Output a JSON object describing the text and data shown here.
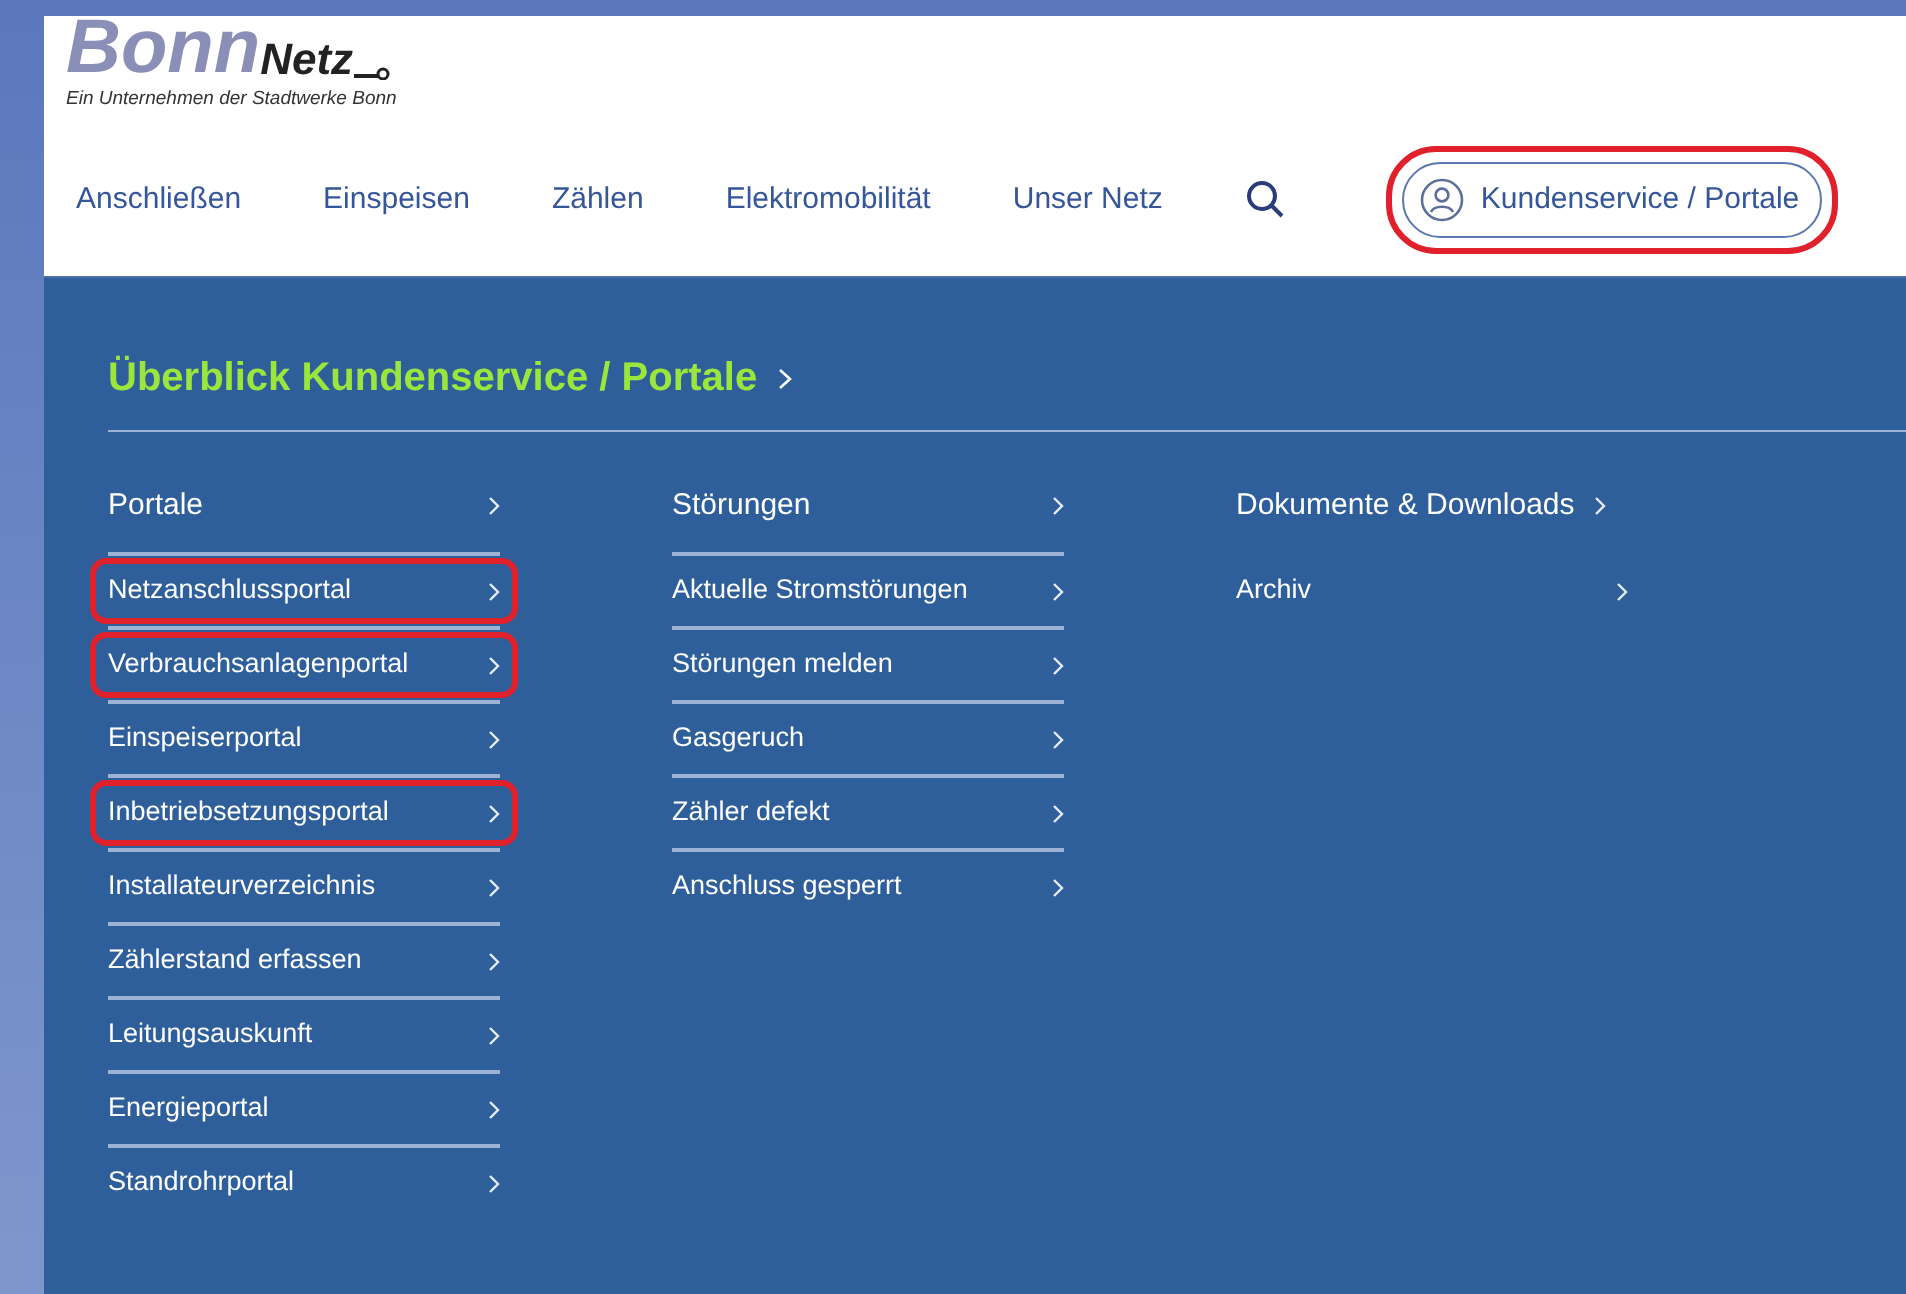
{
  "logo": {
    "brand_part_1": "Bonn",
    "brand_part_2": "Netz",
    "tagline": "Ein Unternehmen der Stadtwerke Bonn"
  },
  "nav": {
    "items": [
      "Anschließen",
      "Einspeisen",
      "Zählen",
      "Elektromobilität",
      "Unser Netz"
    ],
    "account_button": {
      "label": "Kundenservice / Portale",
      "highlighted": true
    }
  },
  "menu": {
    "title": "Überblick Kundenservice / Portale",
    "columns": [
      {
        "heading": "Portale",
        "items": [
          {
            "label": "Netzanschlussportal",
            "highlighted": true
          },
          {
            "label": "Verbrauchsanlagenportal",
            "highlighted": true
          },
          {
            "label": "Einspeiserportal",
            "highlighted": false
          },
          {
            "label": "Inbetriebsetzungsportal",
            "highlighted": true
          },
          {
            "label": "Installateurverzeichnis",
            "highlighted": false
          },
          {
            "label": "Zählerstand erfassen",
            "highlighted": false
          },
          {
            "label": "Leitungsauskunft",
            "highlighted": false
          },
          {
            "label": "Energieportal",
            "highlighted": false
          },
          {
            "label": "Standrohrportal",
            "highlighted": false
          }
        ]
      },
      {
        "heading": "Störungen",
        "items": [
          {
            "label": "Aktuelle Stromstörungen",
            "highlighted": false
          },
          {
            "label": "Störungen melden",
            "highlighted": false
          },
          {
            "label": "Gasgeruch",
            "highlighted": false
          },
          {
            "label": "Zähler defekt",
            "highlighted": false
          },
          {
            "label": "Anschluss gesperrt",
            "highlighted": false
          }
        ]
      },
      {
        "heading": "Dokumente & Downloads",
        "items": [
          {
            "label": "Archiv",
            "highlighted": false
          }
        ]
      }
    ]
  }
}
